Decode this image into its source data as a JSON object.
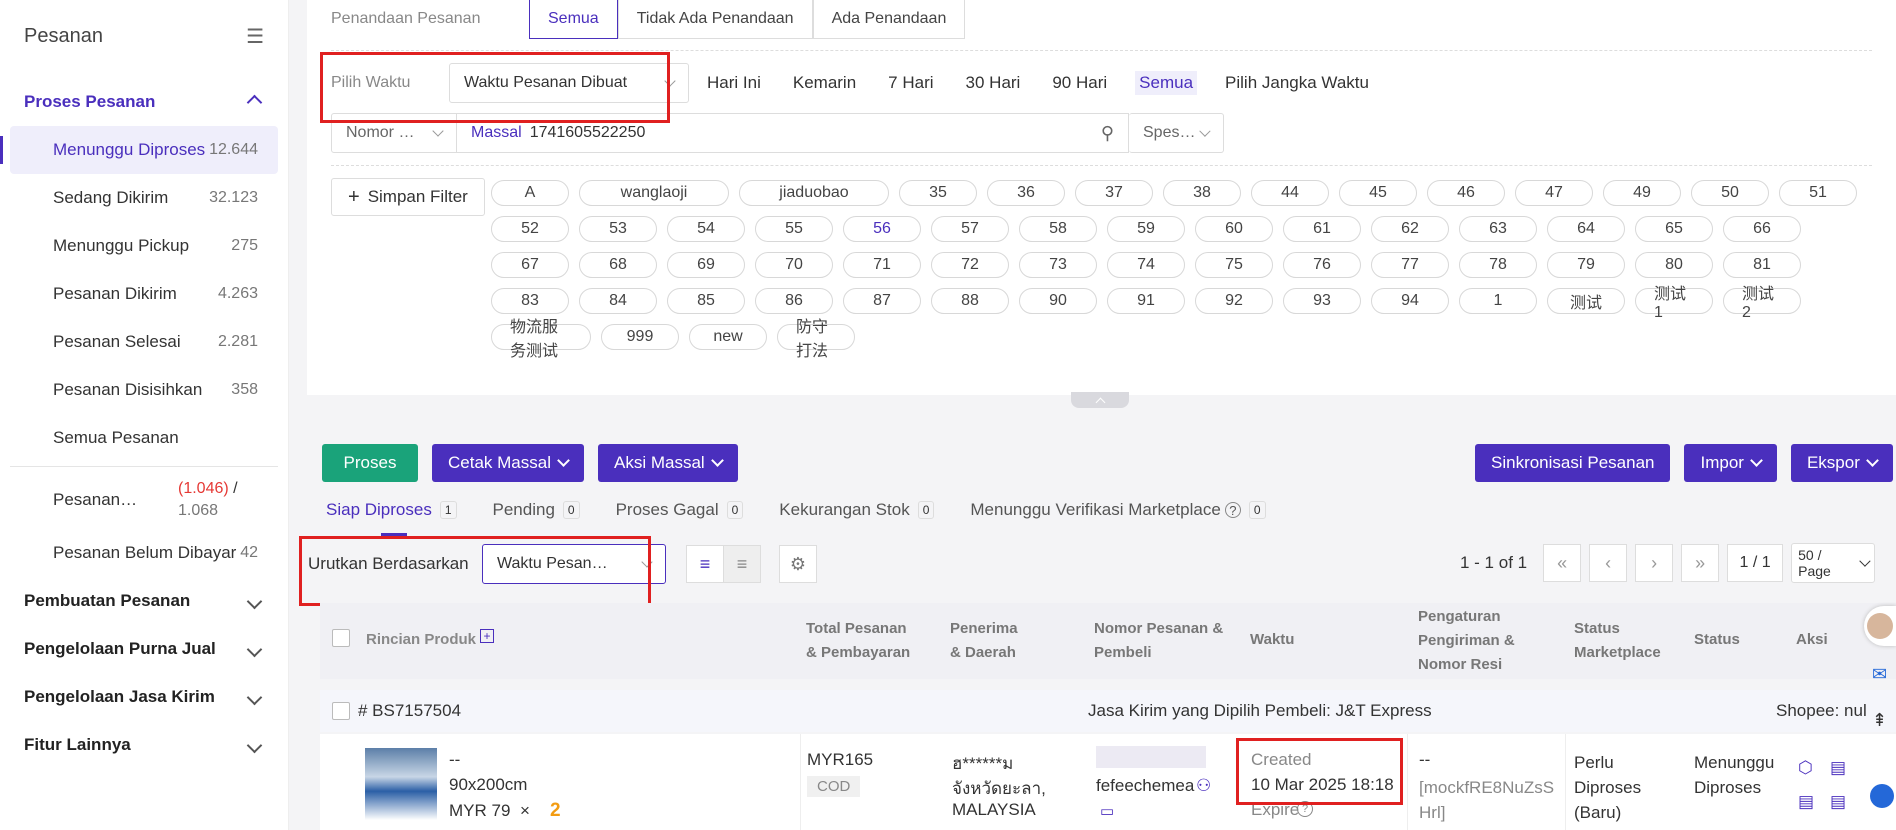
{
  "sidebar": {
    "title": "Pesanan",
    "proses": "Proses Pesanan",
    "items": [
      {
        "label": "Menunggu Diproses",
        "count": "12.644"
      },
      {
        "label": "Sedang Dikirim",
        "count": "32.123"
      },
      {
        "label": "Menunggu Pickup",
        "count": "275"
      },
      {
        "label": "Pesanan Dikirim",
        "count": "4.263"
      },
      {
        "label": "Pesanan Selesai",
        "count": "2.281"
      },
      {
        "label": "Pesanan Disisihkan",
        "count": "358"
      },
      {
        "label": "Semua Pesanan",
        "count": ""
      }
    ],
    "extra1_label": "Pesanan…",
    "extra1_red": "(1.046)",
    "extra1_sep": " /",
    "extra1_total": "1.068",
    "extra2_label": "Pesanan Belum Dibayar",
    "extra2_count": "42",
    "sections": [
      "Pembuatan Pesanan",
      "Pengelolaan Purna Jual",
      "Pengelolaan Jasa Kirim",
      "Fitur Lainnya"
    ]
  },
  "filters": {
    "penandaan_label": "Penandaan Pesanan",
    "penandaan_opts": [
      "Semua",
      "Tidak Ada Penandaan",
      "Ada Penandaan"
    ],
    "waktu_label": "Pilih Waktu",
    "waktu_select": "Waktu Pesanan Dibuat",
    "time_opts": [
      "Hari Ini",
      "Kemarin",
      "7 Hari",
      "30 Hari",
      "90 Hari",
      "Semua",
      "Pilih Jangka Waktu"
    ],
    "search_field": "Nomor …",
    "search_mode": "Massal",
    "search_value": "1741605522250",
    "spes": "Spes…",
    "save_filter": "Simpan Filter",
    "tags": [
      "A",
      "wanglaoji",
      "jiaduobao",
      "35",
      "36",
      "37",
      "38",
      "44",
      "45",
      "46",
      "47",
      "49",
      "50",
      "51",
      "52",
      "53",
      "54",
      "55",
      "56",
      "57",
      "58",
      "59",
      "60",
      "61",
      "62",
      "63",
      "64",
      "65",
      "66",
      "67",
      "68",
      "69",
      "70",
      "71",
      "72",
      "73",
      "74",
      "75",
      "76",
      "77",
      "78",
      "79",
      "80",
      "81",
      "83",
      "84",
      "85",
      "86",
      "87",
      "88",
      "90",
      "91",
      "92",
      "93",
      "94",
      "1",
      "测试",
      "测试1",
      "测试2",
      "物流服务测试",
      "999",
      "new",
      "防守打法"
    ]
  },
  "toolbar": {
    "proses": "Proses",
    "cetak": "Cetak Massal",
    "aksi": "Aksi Massal",
    "sinkron": "Sinkronisasi Pesanan",
    "impor": "Impor",
    "ekspor": "Ekspor"
  },
  "subtabs": [
    {
      "label": "Siap Diproses",
      "count": "1"
    },
    {
      "label": "Pending",
      "count": "0"
    },
    {
      "label": "Proses Gagal",
      "count": "0"
    },
    {
      "label": "Kekurangan Stok",
      "count": "0"
    },
    {
      "label": "Menunggu Verifikasi Marketplace",
      "count": "0"
    }
  ],
  "sort": {
    "label": "Urutkan Berdasarkan",
    "value": "Waktu Pesan…"
  },
  "pager": {
    "range": "1 - 1 of 1",
    "page": "1 / 1",
    "per_page": "50 / Page"
  },
  "table": {
    "headers": [
      "Rincian Produk",
      "Total Pesanan & Pembayaran",
      "Penerima & Daerah",
      "Nomor Pesanan & Pembeli",
      "Waktu",
      "Pengaturan Pengiriman & Nomor Resi",
      "Status Marketplace",
      "Status",
      "Aksi"
    ],
    "order_id": "# BS7157504",
    "courier": "Jasa Kirim yang Dipilih Pembeli: J&T Express",
    "shop": "Shopee: nul",
    "product_dash": "--",
    "product_size": "90x200cm",
    "product_price": "MYR 79",
    "product_x": "×",
    "product_qty": "2",
    "total": "MYR165",
    "payment": "COD",
    "recipient1": "ฮ******ม",
    "recipient2": "จังหวัดยะลา,",
    "recipient3": "MALAYSIA",
    "buyer": "fefeechemea",
    "created_label": "Created",
    "created_time": "10 Mar 2025 18:18",
    "expire": "Expire",
    "ship_dash": "--",
    "resi": "[mockfRE8NuZsSHrl]",
    "mp_status": "Perlu Diproses (Baru)",
    "status": "Menunggu Diproses"
  }
}
